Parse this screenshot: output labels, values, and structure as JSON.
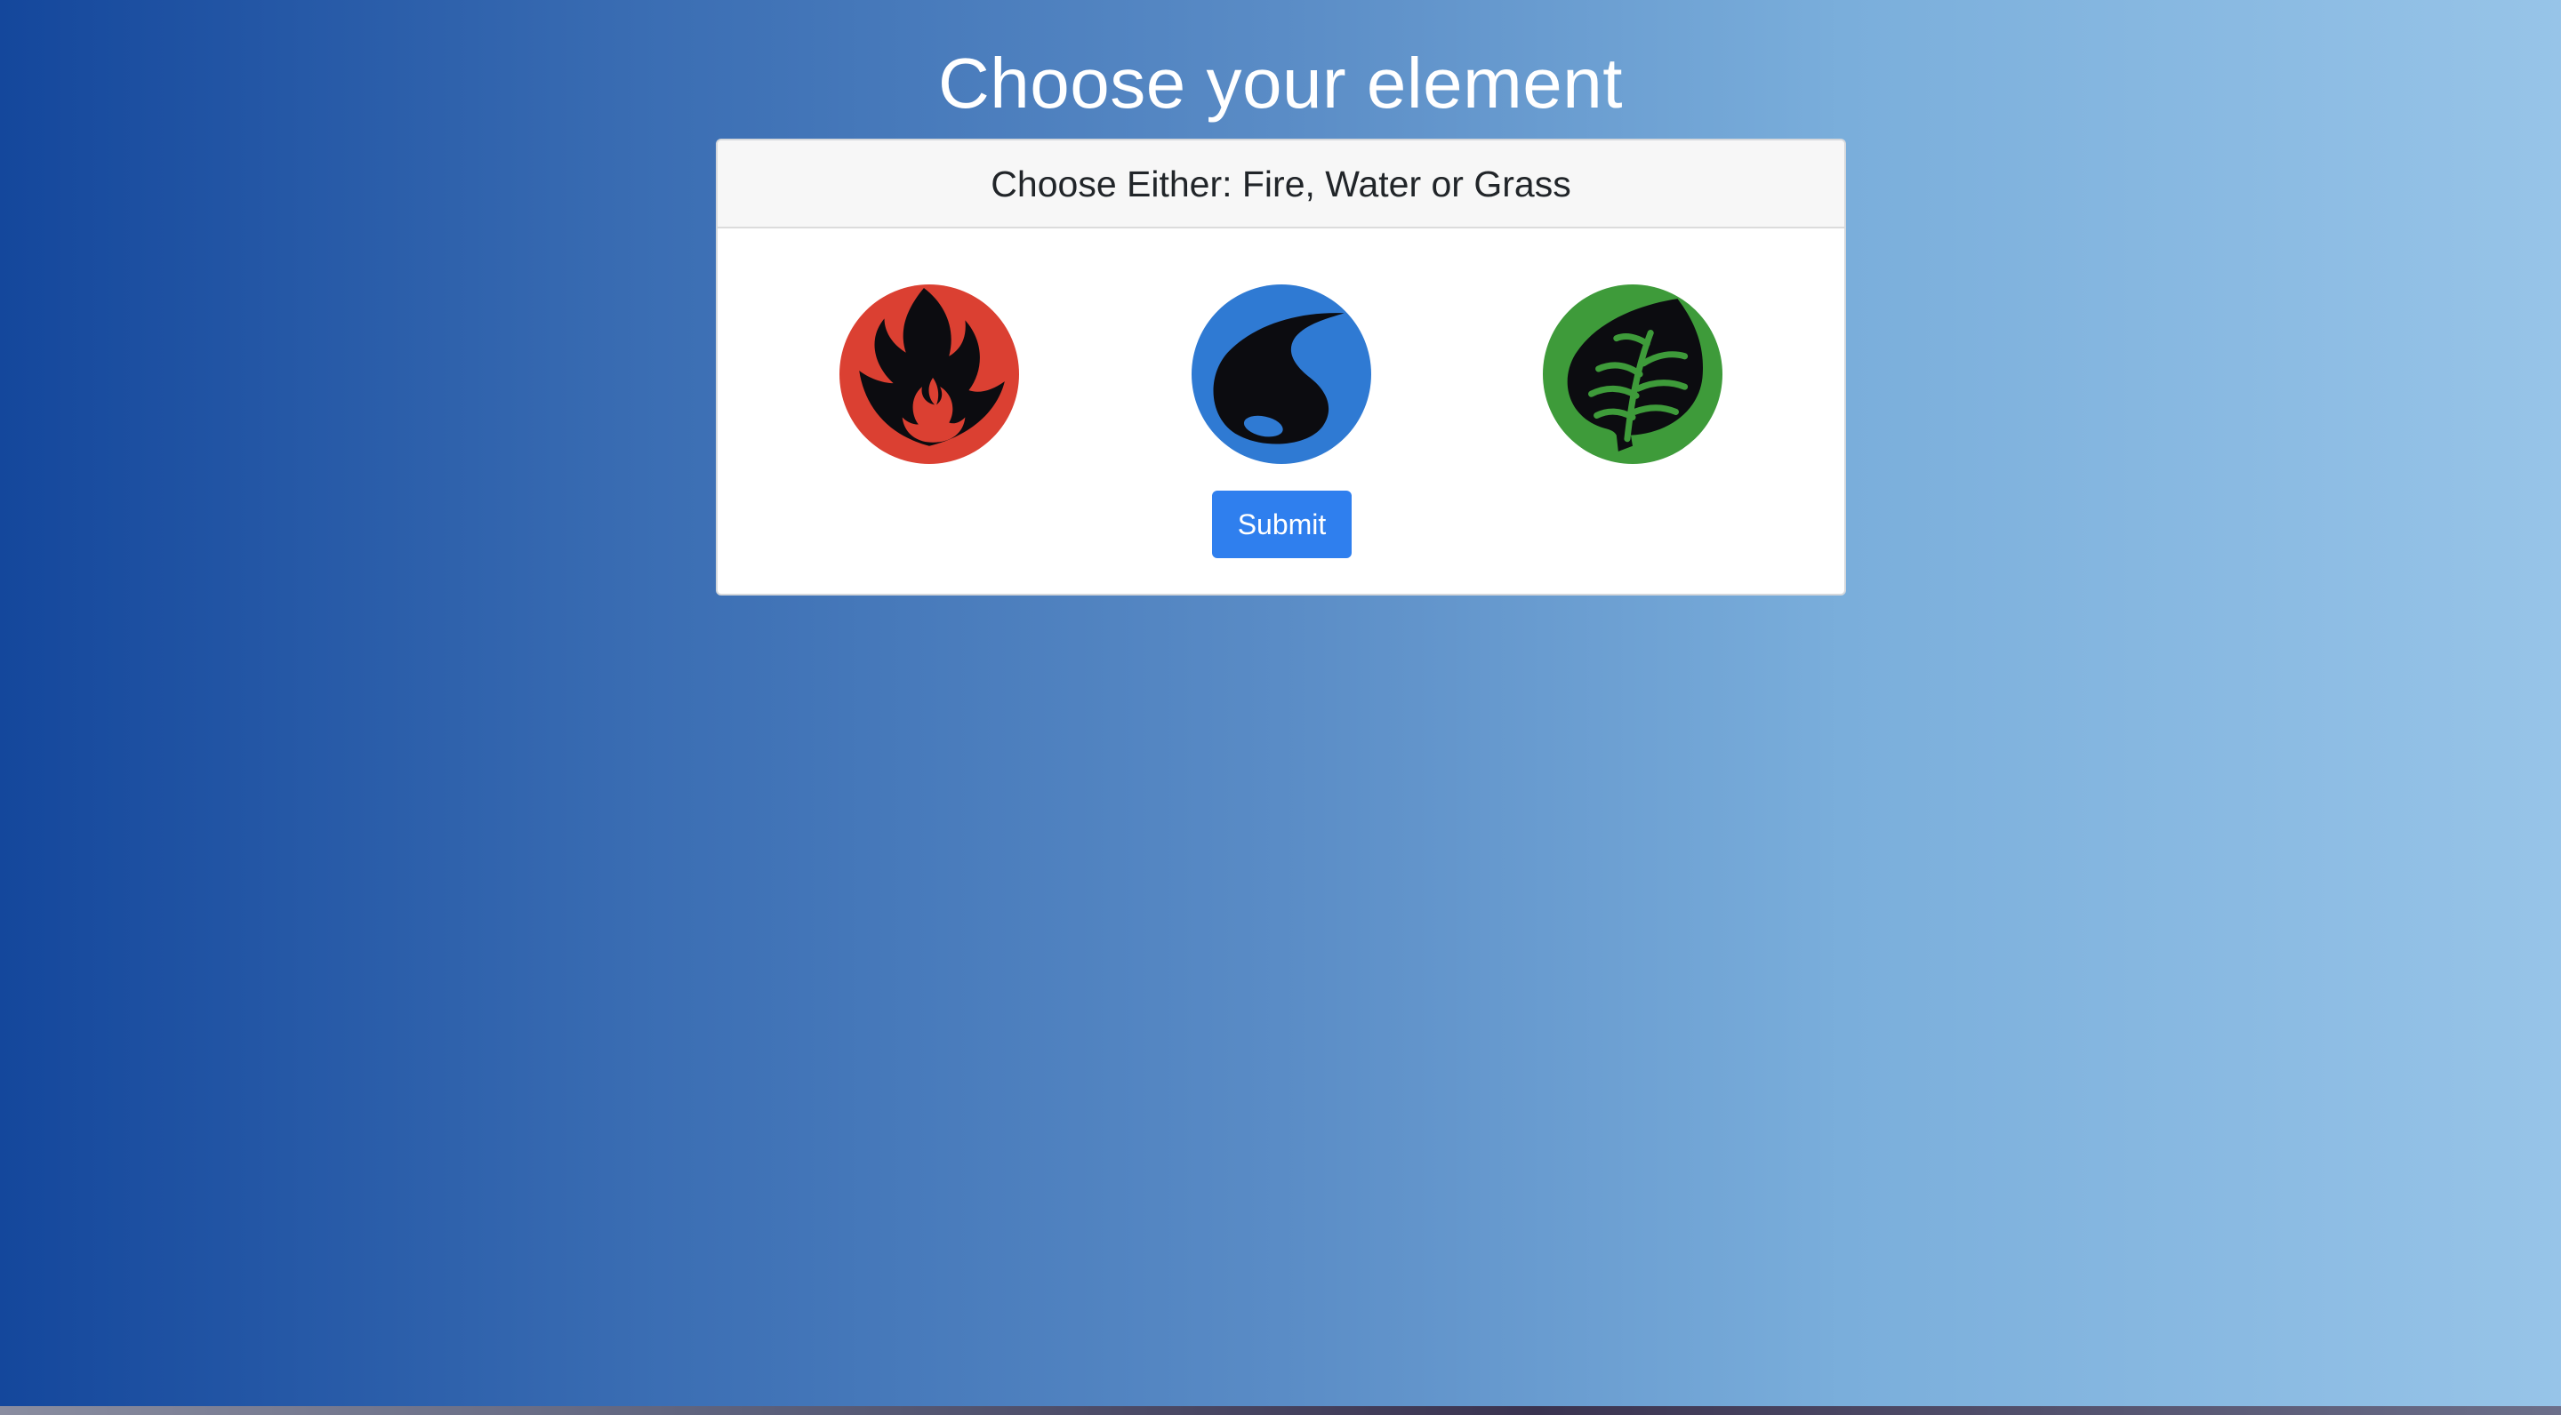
{
  "page": {
    "title": "Choose your element"
  },
  "card": {
    "header": "Choose Either: Fire, Water or Grass",
    "elements": [
      {
        "name": "Fire",
        "icon": "fire-energy-icon",
        "color": "#db4032"
      },
      {
        "name": "Water",
        "icon": "water-energy-icon",
        "color": "#2f7ad3"
      },
      {
        "name": "Grass",
        "icon": "grass-energy-icon",
        "color": "#3e9b3a"
      }
    ],
    "submit_label": "Submit"
  },
  "colors": {
    "gradient_start": "#14479c",
    "gradient_end": "#97c4e8",
    "button": "#2f7fee"
  }
}
